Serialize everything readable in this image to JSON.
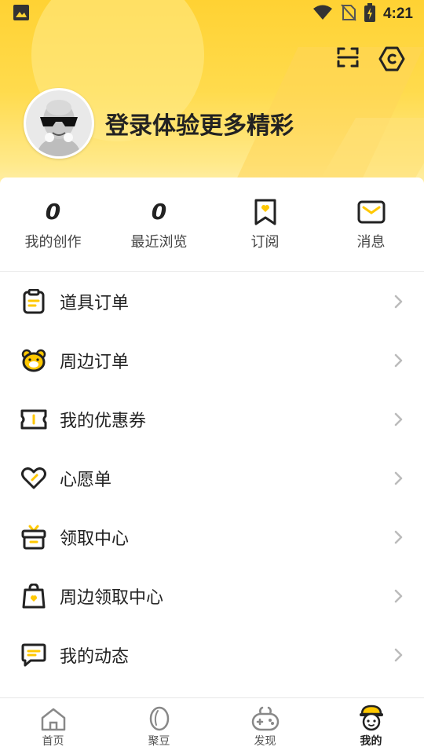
{
  "status_bar": {
    "time": "4:21"
  },
  "header": {
    "login_prompt": "登录体验更多精彩",
    "accent": "#ffd233"
  },
  "stats": [
    {
      "value": "0",
      "label": "我的创作"
    },
    {
      "value": "0",
      "label": "最近浏览"
    },
    {
      "icon": "bookmark-icon",
      "label": "订阅"
    },
    {
      "icon": "mail-icon",
      "label": "消息"
    }
  ],
  "menu": [
    {
      "icon": "clipboard-icon",
      "label": "道具订单"
    },
    {
      "icon": "bear-icon",
      "label": "周边订单"
    },
    {
      "icon": "coupon-icon",
      "label": "我的优惠券"
    },
    {
      "icon": "heart-icon",
      "label": "心愿单"
    },
    {
      "icon": "gift-box-icon",
      "label": "领取中心"
    },
    {
      "icon": "shopping-bag-icon",
      "label": "周边领取中心"
    },
    {
      "icon": "chat-icon",
      "label": "我的动态"
    }
  ],
  "tabbar": [
    {
      "icon": "home-icon",
      "label": "首页"
    },
    {
      "icon": "bean-icon",
      "label": "聚豆"
    },
    {
      "icon": "gamepad-icon",
      "label": "发现"
    },
    {
      "icon": "mascot-icon",
      "label": "我的",
      "active": true
    }
  ]
}
